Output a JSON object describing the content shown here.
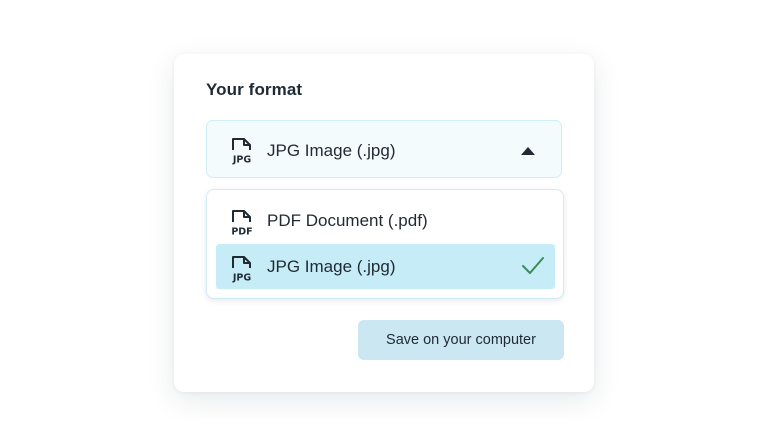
{
  "panel": {
    "title": "Your format"
  },
  "select": {
    "selected_label": "JPG Image (.jpg)",
    "selected_icon_text": "JPG",
    "icon": "file-icon",
    "caret": "caret-up-icon"
  },
  "menu": {
    "options": [
      {
        "label": "PDF Document (.pdf)",
        "icon_text": "PDF",
        "selected": false
      },
      {
        "label": "JPG Image (.jpg)",
        "icon_text": "JPG",
        "selected": true
      }
    ],
    "selected_marker": "check-icon"
  },
  "actions": {
    "save_label": "Save on your computer"
  },
  "colors": {
    "select_bg": "#f4fbfd",
    "selected_option_bg": "#c6edf7",
    "check": "#3b8a5a",
    "save_button_bg": "#cbe7f1",
    "text": "#1f2a33"
  }
}
